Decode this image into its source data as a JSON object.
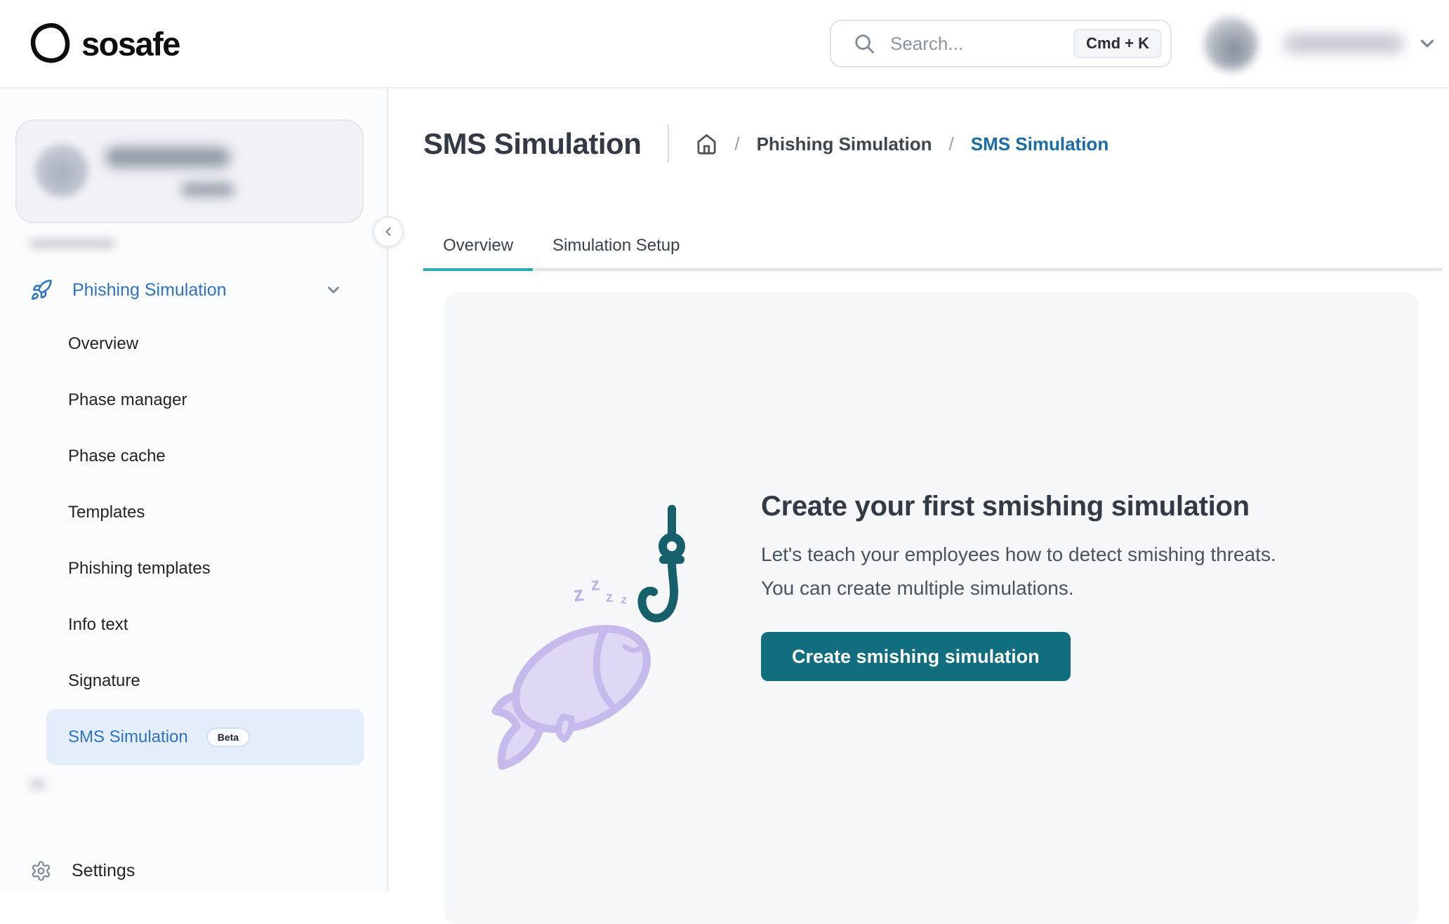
{
  "header": {
    "logo_text": "sosafe",
    "search": {
      "placeholder": "Search...",
      "shortcut": "Cmd + K"
    },
    "user": {
      "avatar": "blurred",
      "name": "blurred"
    }
  },
  "sidebar": {
    "section": {
      "label": "Phishing Simulation"
    },
    "items": [
      {
        "label": "Overview"
      },
      {
        "label": "Phase manager"
      },
      {
        "label": "Phase cache"
      },
      {
        "label": "Templates"
      },
      {
        "label": "Phishing templates"
      },
      {
        "label": "Info text"
      },
      {
        "label": "Signature"
      },
      {
        "label": "SMS Simulation",
        "badge": "Beta",
        "active": true
      }
    ],
    "settings_label": "Settings"
  },
  "page": {
    "title": "SMS Simulation",
    "breadcrumb": {
      "separator": "/",
      "parent": "Phishing Simulation",
      "current": "SMS Simulation"
    },
    "tabs": [
      {
        "label": "Overview",
        "active": true
      },
      {
        "label": "Simulation Setup",
        "active": false
      }
    ]
  },
  "main": {
    "empty_state": {
      "heading": "Create your first smishing simulation",
      "body_line1": "Let's teach your employees how to detect smishing threats.",
      "body_line2": "You can create multiple simulations.",
      "cta_label": "Create smishing simulation",
      "illustration": "sleeping-fish-and-hook",
      "sleep_letters": "zzzz"
    }
  },
  "icons": {
    "logo_mark": "sosafe-ring",
    "search": "magnifier",
    "user_menu": "chevron-down",
    "section": "rocket",
    "section_expand": "chevron-down",
    "sidebar_collapse": "chevron-left",
    "breadcrumb_home": "home",
    "settings": "gear"
  },
  "colors": {
    "accent_blue": "#2e72c7",
    "breadcrumb_blue": "#1a6ca7",
    "tab_teal": "#29abb7",
    "button_teal": "#116e7e",
    "hook_teal": "#15606b",
    "fish_lavender_fill": "#ded8f4",
    "fish_lavender_stroke": "#c5baeb",
    "card_bg": "#f6f7f9",
    "active_item_bg": "#e4eefb"
  }
}
